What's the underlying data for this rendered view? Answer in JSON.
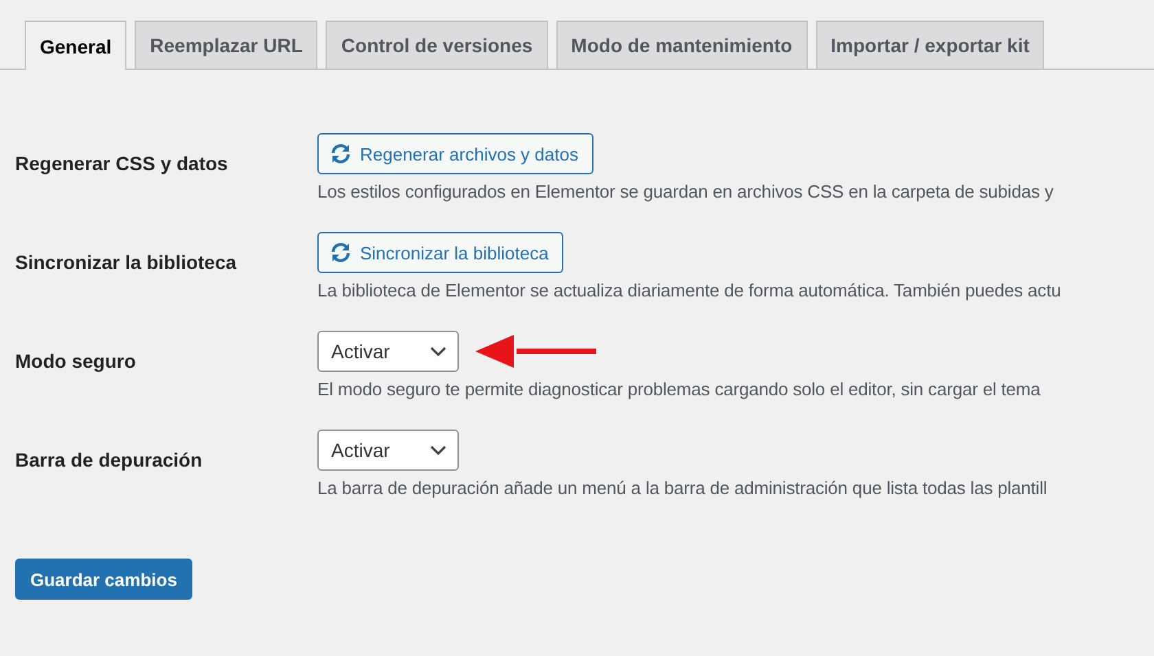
{
  "tabs": [
    {
      "label": "General",
      "selected": true
    },
    {
      "label": "Reemplazar URL",
      "selected": false
    },
    {
      "label": "Control de versiones",
      "selected": false
    },
    {
      "label": "Modo de mantenimiento",
      "selected": false
    },
    {
      "label": "Importar / exportar kit",
      "selected": false
    }
  ],
  "settings": [
    {
      "label": "Regenerar CSS y datos",
      "kind": "button",
      "control": "Regenerar archivos y datos",
      "description": "Los estilos configurados en Elementor se guardan en archivos CSS en la carpeta de subidas y"
    },
    {
      "label": "Sincronizar la biblioteca",
      "kind": "button",
      "control": "Sincronizar la biblioteca",
      "description": "La biblioteca de Elementor se actualiza diariamente de forma automática. También puedes actu"
    },
    {
      "label": "Modo seguro",
      "kind": "select",
      "control": "Activar",
      "annotated": true,
      "description": "El modo seguro te permite diagnosticar problemas cargando solo el editor, sin cargar el tema"
    },
    {
      "label": "Barra de depuración",
      "kind": "select",
      "control": "Activar",
      "annotated": false,
      "description": "La barra de depuración añade un menú a la barra de administración que lista todas las plantill"
    }
  ],
  "save_button": "Guardar cambios"
}
